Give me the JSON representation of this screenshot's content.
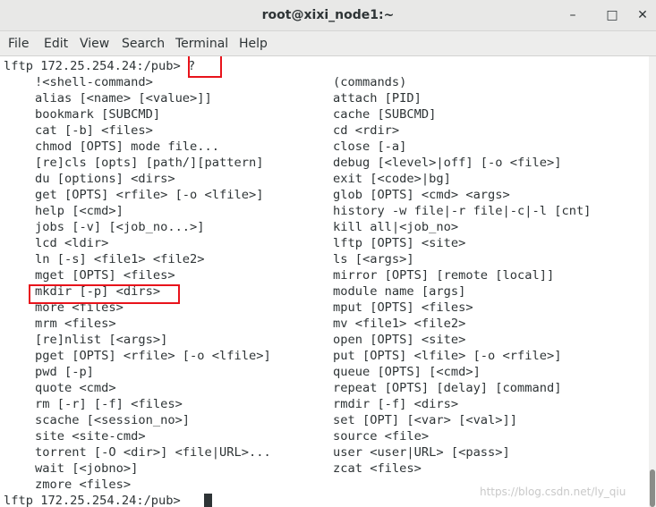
{
  "window": {
    "title": "root@xixi_node1:~",
    "minimize_glyph": "–",
    "maximize_glyph": "□",
    "close_glyph": "✕"
  },
  "menubar": [
    "File",
    "Edit",
    "View",
    "Search",
    "Terminal",
    "Help"
  ],
  "terminal": {
    "prompt_command": "lftp 172.25.254.24:/pub> ?",
    "left_column": [
      "!<shell-command>",
      "alias [<name> [<value>]]",
      "bookmark [SUBCMD]",
      "cat [-b] <files>",
      "chmod [OPTS] mode file...",
      "[re]cls [opts] [path/][pattern]",
      "du [options] <dirs>",
      "get [OPTS] <rfile> [-o <lfile>]",
      "help [<cmd>]",
      "jobs [-v] [<job_no...>]",
      "lcd <ldir>",
      "ln [-s] <file1> <file2>",
      "mget [OPTS] <files>",
      "mkdir [-p] <dirs>",
      "more <files>",
      "mrm <files>",
      "[re]nlist [<args>]",
      "pget [OPTS] <rfile> [-o <lfile>]",
      "pwd [-p]",
      "quote <cmd>",
      "rm [-r] [-f] <files>",
      "scache [<session_no>]",
      "site <site-cmd>",
      "torrent [-O <dir>] <file|URL>...",
      "wait [<jobno>]",
      "zmore <files>"
    ],
    "right_column": [
      "(commands)",
      "attach [PID]",
      "cache [SUBCMD]",
      "cd <rdir>",
      "close [-a]",
      "debug [<level>|off] [-o <file>]",
      "exit [<code>|bg]",
      "glob [OPTS] <cmd> <args>",
      "history -w file|-r file|-c|-l [cnt]",
      "kill all|<job_no>",
      "lftp [OPTS] <site>",
      "ls [<args>]",
      "mirror [OPTS] [remote [local]]",
      "module name [args]",
      "mput [OPTS] <files>",
      "mv <file1> <file2>",
      "open [OPTS] <site>",
      "put [OPTS] <lfile> [-o <rfile>]",
      "queue [OPTS] [<cmd>]",
      "repeat [OPTS] [delay] [command]",
      "rmdir [-f] <dirs>",
      "set [OPT] [<var> [<val>]]",
      "source <file>",
      "user <user|URL> [<pass>]",
      "zcat <files>"
    ],
    "final_prompt": "lftp 172.25.254.24:/pub> "
  },
  "watermark": "https://blog.csdn.net/ly_qiu",
  "colors": {
    "highlight": "#e8131b",
    "text": "#2e3436"
  }
}
